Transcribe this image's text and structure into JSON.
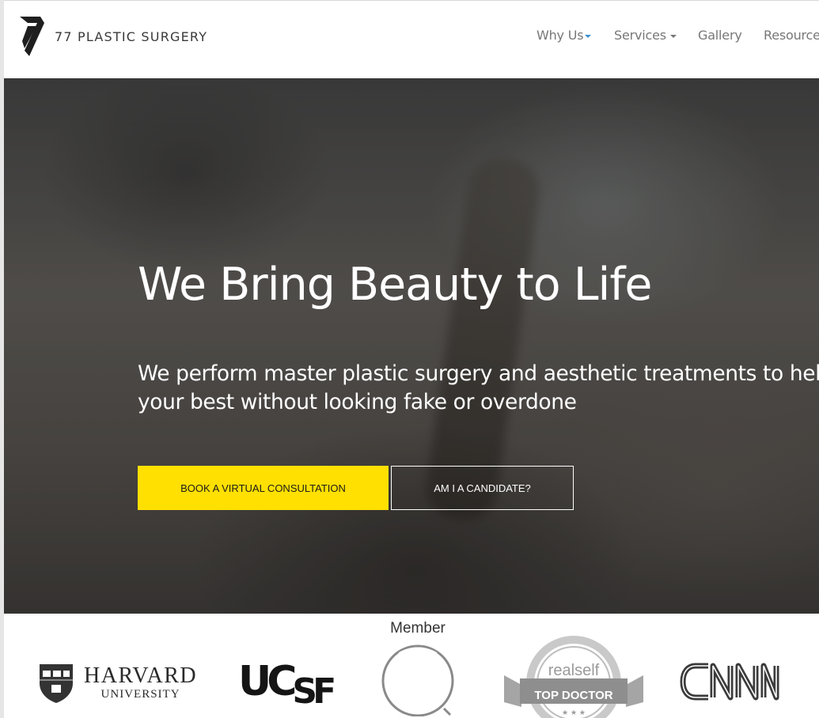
{
  "header": {
    "logo_text": "77 PLASTIC SURGERY",
    "nav": [
      {
        "label": "Why Us",
        "has_caret": true
      },
      {
        "label": "Services",
        "has_caret": true
      },
      {
        "label": "Gallery",
        "has_caret": false
      },
      {
        "label": "Resources",
        "has_caret": false
      }
    ]
  },
  "hero": {
    "title": "We Bring Beauty to Life",
    "subtitle": "We perform master plastic surgery and aesthetic treatments to help you look your best without looking fake or overdone",
    "primary_button": "BOOK A VIRTUAL CONSULTATION",
    "secondary_button": "AM I A CANDIDATE?"
  },
  "logos": {
    "harvard_name": "HARVARD",
    "harvard_sub": "UNIVERSITY",
    "ucsf_left": "UC",
    "ucsf_right": "SF",
    "member_label": "Member",
    "realself_brand": "realself",
    "realself_badge": "TOP DOCTOR",
    "realself_stars": "★ ★ ★"
  },
  "colors": {
    "accent_yellow": "#ffe000",
    "nav_text": "#777777",
    "caret_blue": "#3a8fd0"
  }
}
